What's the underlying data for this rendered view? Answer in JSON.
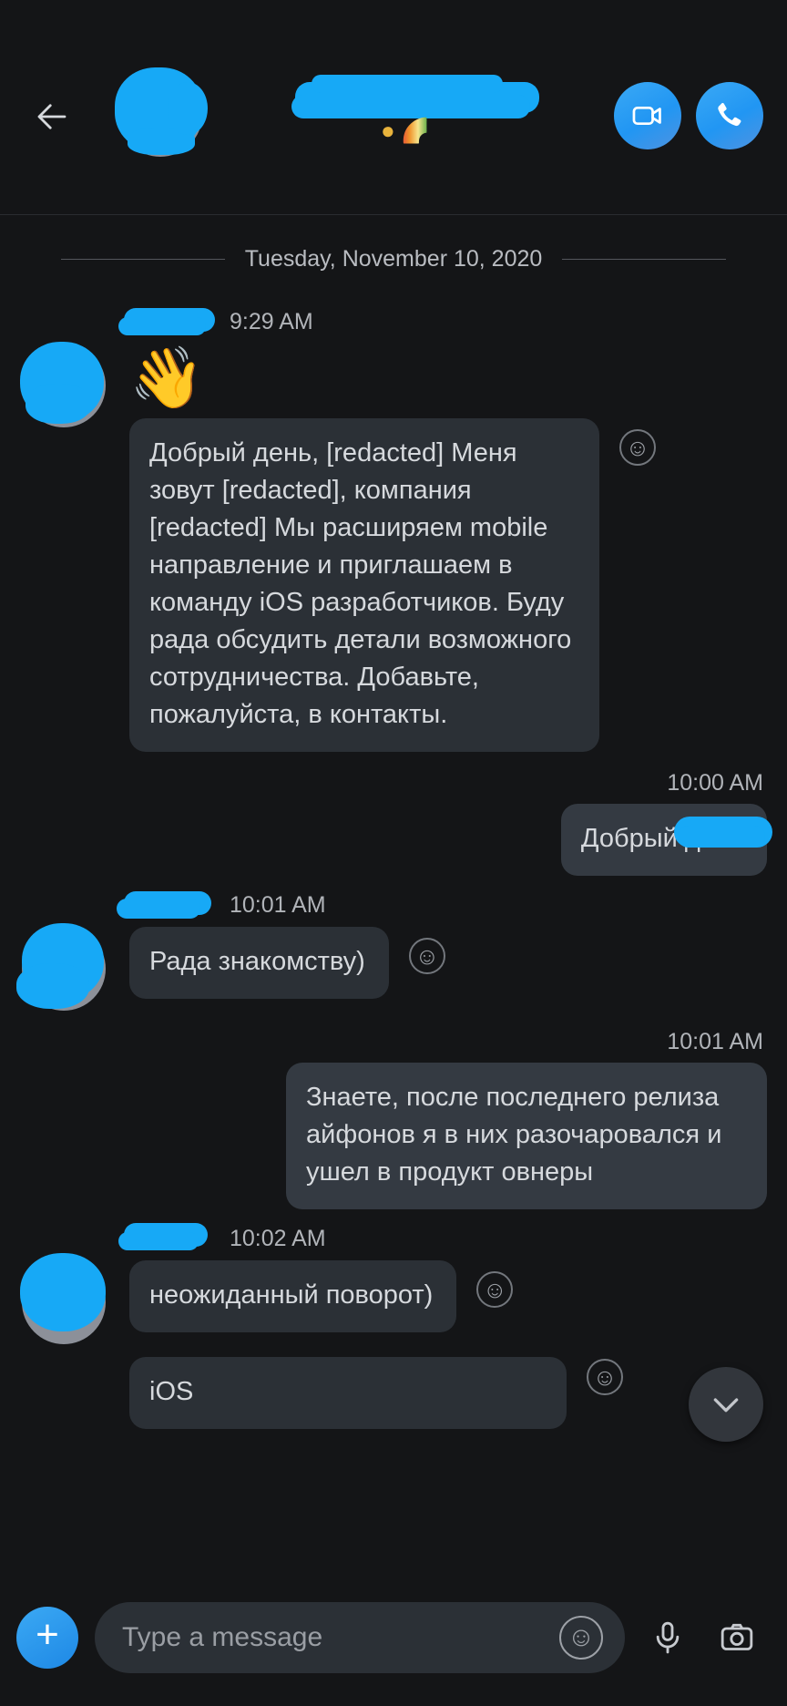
{
  "header": {
    "back_icon": "back-arrow-icon",
    "peer_name": "[redacted]",
    "peer_emojis": "🟡🌈",
    "video_call_label": "video-call",
    "voice_call_label": "voice-call"
  },
  "chat": {
    "date_divider": "Tuesday, November 10, 2020",
    "messages": [
      {
        "id": "m1",
        "direction": "in",
        "sender": "[redacted]",
        "time": "9:29 AM",
        "emoji_sticker": "👋",
        "text": "Добрый день, [redacted] Меня зовут [redacted], компания [redacted] Мы расширяем mobile направление и приглашаем в команду iOS  разработчиков. Буду рада обсудить детали возможного сотрудничества. Добавьте, пожалуйста, в контакты.",
        "reaction": "☺"
      },
      {
        "id": "m2",
        "direction": "out",
        "time": "10:00 AM",
        "text": "Добрый день"
      },
      {
        "id": "m3",
        "direction": "in",
        "sender": "[redacted]",
        "time": "10:01 AM",
        "text": "Рада знакомству)",
        "reaction": "☺"
      },
      {
        "id": "m4",
        "direction": "out",
        "time": "10:01 AM",
        "text": "Знаете, после последнего релиза айфонов я в них разочаровался и ушел в продукт овнеры"
      },
      {
        "id": "m5",
        "direction": "in",
        "sender": "[redacted]",
        "time": "10:02 AM",
        "text": "неожиданный поворот)",
        "reaction": "☺"
      },
      {
        "id": "m6",
        "direction": "in",
        "text": "iOS",
        "reaction": "☺"
      }
    ],
    "scroll_down_icon": "chevron-down-icon"
  },
  "composer": {
    "attach_label": "+",
    "placeholder": "Type a message",
    "emoji_icon": "smiley-icon",
    "mic_icon": "microphone-icon",
    "camera_icon": "camera-icon"
  },
  "colors": {
    "accent": "#17a9f6",
    "bubble_in": "#2b3036",
    "bubble_out": "#343a42",
    "background": "#141517"
  }
}
